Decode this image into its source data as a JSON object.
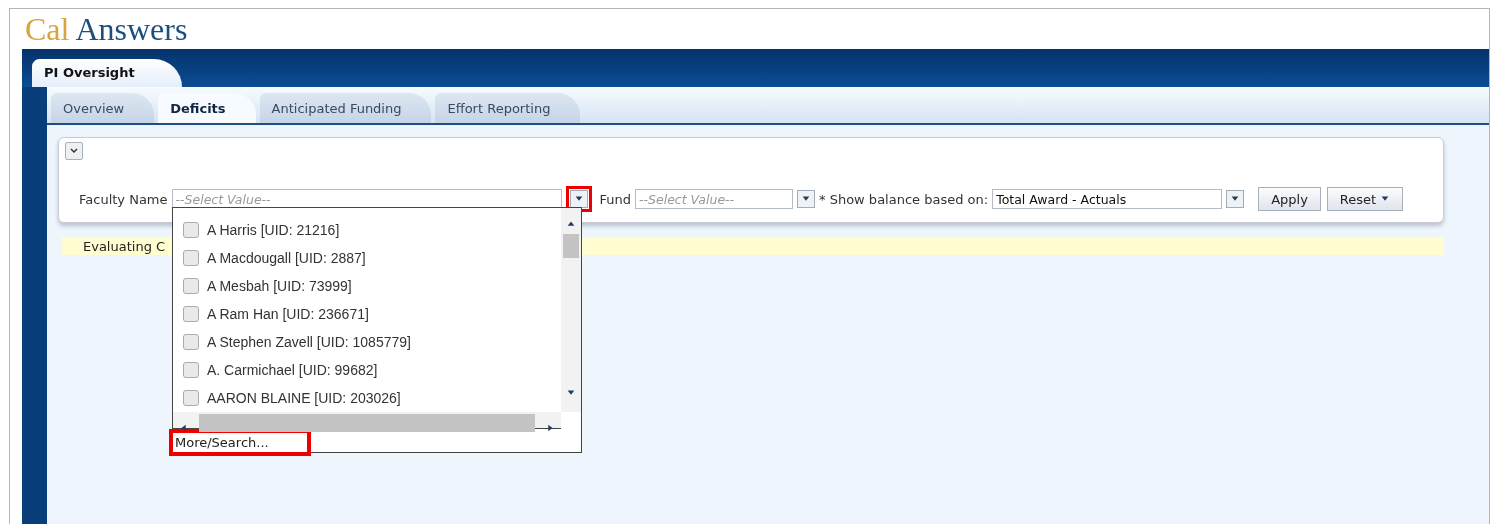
{
  "logo": {
    "part_1": "Cal",
    "part_2": "Answers"
  },
  "dashboard_tab": {
    "label": "PI Oversight",
    "selected": true
  },
  "tabs": [
    {
      "label": "Overview",
      "selected": false
    },
    {
      "label": "Deficits",
      "selected": true
    },
    {
      "label": "Anticipated Funding",
      "selected": false
    },
    {
      "label": "Effort Reporting",
      "selected": false
    }
  ],
  "filters": {
    "faculty_name": {
      "label": "Faculty Name",
      "placeholder": "--Select Value--",
      "highlighted": true
    },
    "fund": {
      "label": "Fund",
      "placeholder": "--Select Value--"
    },
    "balance": {
      "label": "* Show balance based on:",
      "value": "Total Award - Actuals"
    },
    "buttons": [
      {
        "label": "Apply",
        "kind": "plain"
      },
      {
        "label": "Reset",
        "kind": "menu"
      }
    ]
  },
  "status_message": "Evaluating C",
  "dropdown": {
    "options": [
      {
        "label": "A Harris [UID: 21216]",
        "checked": false
      },
      {
        "label": "A Macdougall [UID: 2887]",
        "checked": false
      },
      {
        "label": "A Mesbah [UID: 73999]",
        "checked": false
      },
      {
        "label": "A Ram Han [UID: 236671]",
        "checked": false
      },
      {
        "label": "A Stephen Zavell [UID: 1085779]",
        "checked": false
      },
      {
        "label": "A. Carmichael [UID: 99682]",
        "checked": false
      },
      {
        "label": "AARON BLAINE [UID: 203026]",
        "checked": false
      }
    ],
    "more_link": {
      "label": "More/Search...",
      "highlighted": true
    }
  }
}
